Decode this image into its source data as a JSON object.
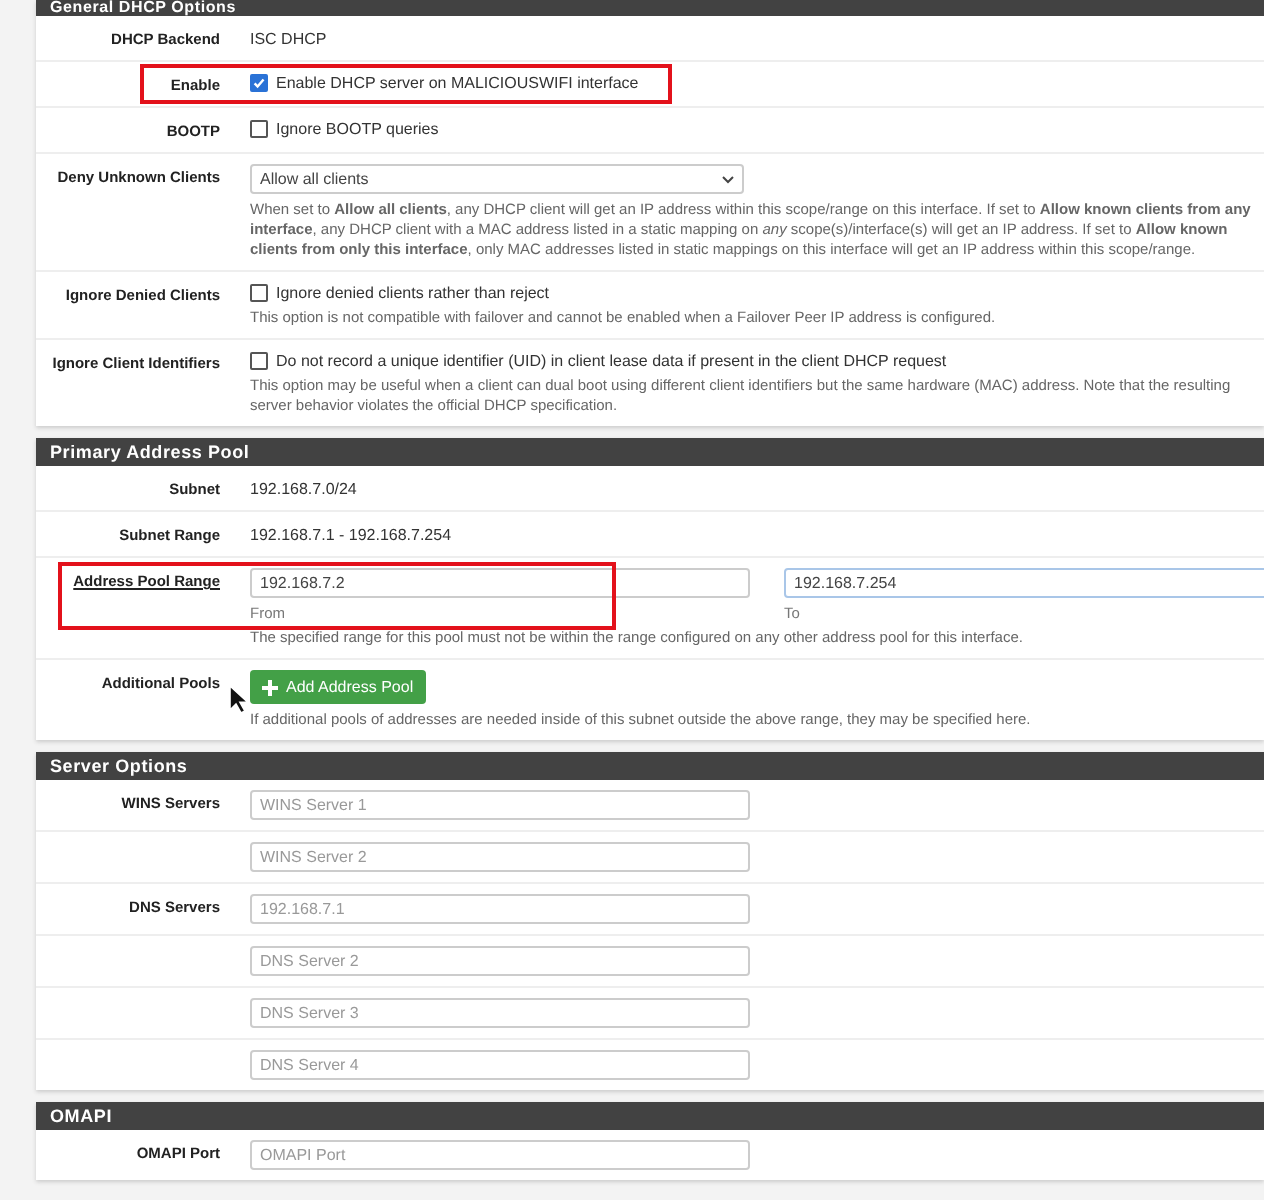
{
  "sections": [
    {
      "title": "General DHCP Options",
      "rows": [
        {
          "kind": "text",
          "label": "DHCP Backend",
          "value": "ISC DHCP",
          "highlighted": false
        },
        {
          "kind": "checkbox",
          "label": "Enable",
          "text": "Enable DHCP server on MALICIOUSWIFI interface",
          "checked": true,
          "highlighted": true
        },
        {
          "kind": "checkbox",
          "label": "BOOTP",
          "text": "Ignore BOOTP queries",
          "checked": false,
          "highlighted": false
        },
        {
          "kind": "select",
          "label": "Deny Unknown Clients",
          "value": "Allow all clients",
          "help": "When set to **Allow all clients**, any DHCP client will get an IP address within this scope/range on this interface. If set to **Allow known clients from any interface**, any DHCP client with a MAC address listed in a static mapping on *any* scope(s)/interface(s) will get an IP address. If set to **Allow known clients from only this interface**, only MAC addresses listed in static mappings on this interface will get an IP address within this scope/range.",
          "highlighted": false
        },
        {
          "kind": "checkbox",
          "label": "Ignore Denied Clients",
          "text": "Ignore denied clients rather than reject",
          "checked": false,
          "help": "This option is not compatible with failover and cannot be enabled when a Failover Peer IP address is configured.",
          "highlighted": false
        },
        {
          "kind": "checkbox",
          "label": "Ignore Client Identifiers",
          "text": "Do not record a unique identifier (UID) in client lease data if present in the client DHCP request",
          "checked": false,
          "help": "This option may be useful when a client can dual boot using different client identifiers but the same hardware (MAC) address. Note that the resulting server behavior violates the official DHCP specification.",
          "highlighted": false
        }
      ]
    },
    {
      "title": "Primary Address Pool",
      "rows": [
        {
          "kind": "text",
          "label": "Subnet",
          "value": "192.168.7.0/24",
          "highlighted": false
        },
        {
          "kind": "text",
          "label": "Subnet Range",
          "value": "192.168.7.1 - 192.168.7.254",
          "highlighted": false
        },
        {
          "kind": "range",
          "label": "Address Pool Range",
          "from": "192.168.7.2",
          "from_caption": "From",
          "to": "192.168.7.254",
          "to_caption": "To",
          "help": "The specified range for this pool must not be within the range configured on any other address pool for this interface.",
          "highlighted": true
        },
        {
          "kind": "button",
          "label": "Additional Pools",
          "button": "Add Address Pool",
          "help": "If additional pools of addresses are needed inside of this subnet outside the above range, they may be specified here.",
          "highlighted": false
        }
      ]
    },
    {
      "title": "Server Options",
      "rows": [
        {
          "kind": "input",
          "label": "WINS Servers",
          "placeholder": "WINS Server 1",
          "highlighted": false
        },
        {
          "kind": "input",
          "placeholder": "WINS Server 2",
          "highlighted": false
        },
        {
          "kind": "input",
          "label": "DNS Servers",
          "placeholder": "192.168.7.1",
          "highlighted": false
        },
        {
          "kind": "input",
          "placeholder": "DNS Server 2",
          "highlighted": false
        },
        {
          "kind": "input",
          "placeholder": "DNS Server 3",
          "highlighted": false
        },
        {
          "kind": "input",
          "placeholder": "DNS Server 4",
          "highlighted": false
        }
      ]
    },
    {
      "title": "OMAPI",
      "rows": [
        {
          "kind": "input",
          "label": "OMAPI Port",
          "placeholder": "OMAPI Port",
          "highlighted": false
        }
      ]
    }
  ]
}
